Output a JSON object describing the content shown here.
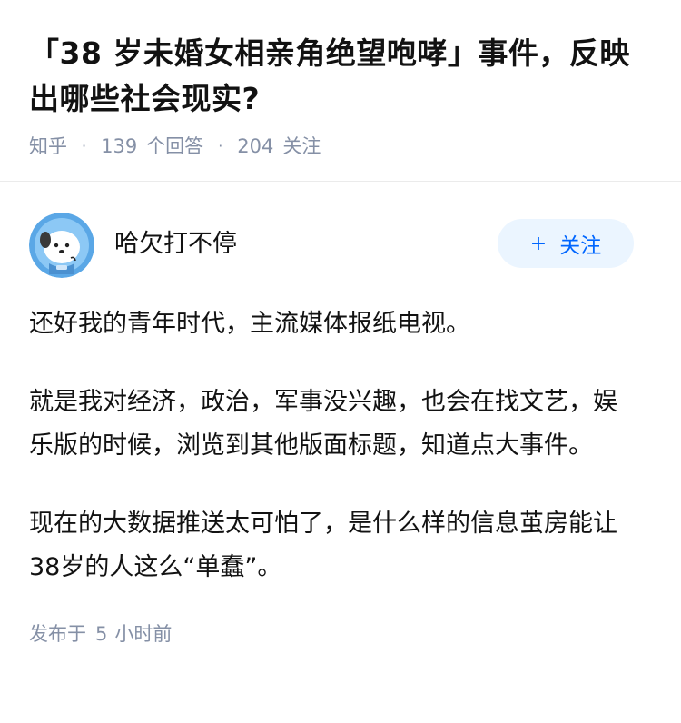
{
  "question": {
    "title": "「38 岁未婚女相亲角绝望咆哮」事件，反映出哪些社会现实?",
    "source": "知乎",
    "answer_count": "139",
    "answer_label": "个回答",
    "follower_count": "204",
    "follower_label": "关注",
    "separator": "·"
  },
  "answer": {
    "author_name": "哈欠打不停",
    "follow_button": {
      "icon": "+",
      "label": "关注"
    },
    "paragraphs": [
      "还好我的青年时代，主流媒体报纸电视。",
      "就是我对经济，政治，军事没兴趣，也会在找文艺，娱乐版的时候，浏览到其他版面标题，知道点大事件。",
      "现在的大数据推送太可怕了，是什么样的信息茧房能让38岁的人这么“单蠢”。"
    ],
    "publish": {
      "prefix": "发布于",
      "value": "5",
      "suffix": "小时前"
    }
  },
  "colors": {
    "title": "#121212",
    "meta": "#8590a6",
    "accent": "#0066ff",
    "accent_bg": "#ebf5ff",
    "avatar_bg": "#5aa7e6"
  },
  "icons": {
    "avatar": "dog-astronaut-avatar",
    "follow": "plus-icon"
  }
}
